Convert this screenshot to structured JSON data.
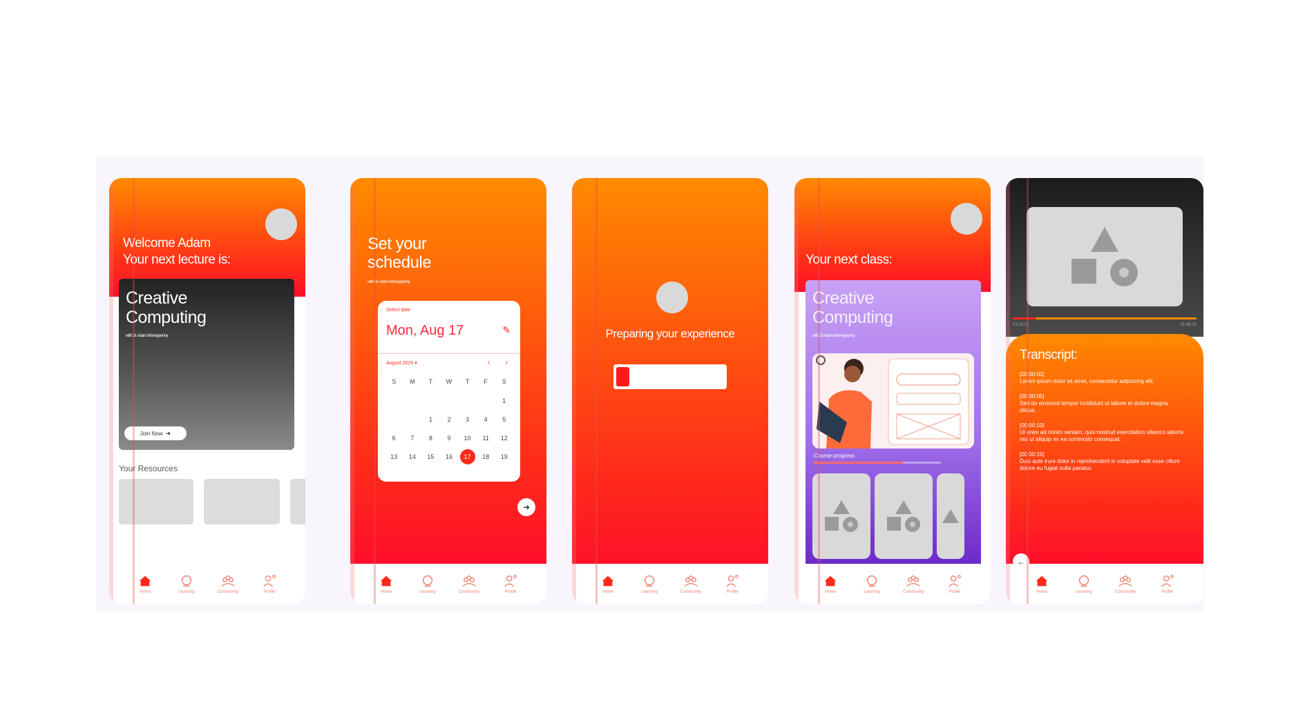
{
  "screens": {
    "home": {
      "greeting": "Welcome Adam",
      "next_lecture_label": "Your next lecture is:",
      "course_title_line1": "Creative",
      "course_title_line2": "Computing",
      "lecturer": "with Dr. Adam Moneypenny",
      "join_button": "Join Now",
      "resources_label": "Your Resources"
    },
    "schedule": {
      "title_line1": "Set your",
      "title_line2": "schedule",
      "lecturer": "with Dr. Adam Moneypenny",
      "select_date_label": "Select date",
      "selected_date": "Mon, Aug 17",
      "month_label": "August 2025",
      "weekdays": [
        "S",
        "M",
        "T",
        "W",
        "T",
        "F",
        "S"
      ],
      "day_rows": [
        [
          "",
          "",
          "",
          "",
          "",
          "",
          "1"
        ],
        [
          "",
          "",
          "1",
          "2",
          "3",
          "4",
          "5"
        ],
        [
          "6",
          "7",
          "8",
          "9",
          "10",
          "11",
          "12"
        ],
        [
          "13",
          "14",
          "15",
          "16",
          "17",
          "18",
          "19"
        ]
      ]
    },
    "loading": {
      "message": "Preparing your experience",
      "progress": 0.12
    },
    "course": {
      "header": "Your next class:",
      "course_title_line1": "Creative",
      "course_title_line2": "Computing",
      "lecturer": "with Dr. Adam Moneypenny",
      "progress_label": "Course progress",
      "progress": 0.7
    },
    "transcript": {
      "time_start": "01:10:22",
      "time_end": "01:45:10",
      "heading": "Transcript:",
      "entries": [
        {
          "time": "[00:00:00]",
          "text": "Lorem ipsum dolor sit amet, consectetur adipiscing elit."
        },
        {
          "time": "[00:00:05]",
          "text": "Sed do eiusmod tempor incididunt ut labore et dolore magna aliqua."
        },
        {
          "time": "[00:00:10]",
          "text": "Ut enim ad minim veniam, quis nostrud exercitation ullamco laboris nisi ut aliquip ex ea commodo consequat."
        },
        {
          "time": "[00:00:15]",
          "text": "Duis aute irure dolor in reprehenderit in voluptate velit esse cillum dolore eu fugiat nulla pariatur."
        }
      ]
    }
  },
  "nav": [
    "Home",
    "Learning",
    "Community",
    "Profile"
  ],
  "colors": {
    "accent": "#ff2a1a",
    "orange": "#ff8a00",
    "purple": "#b48cf0"
  }
}
